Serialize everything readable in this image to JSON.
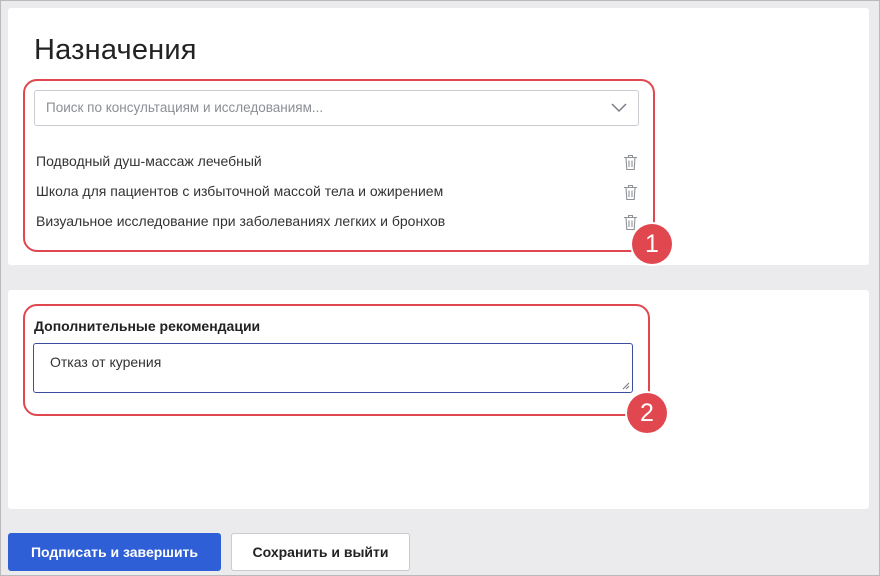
{
  "appointments": {
    "title": "Назначения",
    "search": {
      "placeholder": "Поиск по консультациям и исследованиям..."
    },
    "items": [
      {
        "label": "Подводный душ-массаж лечебный"
      },
      {
        "label": "Школа для пациентов с избыточной массой тела и ожирением"
      },
      {
        "label": "Визуальное исследование при заболеваниях легких и бронхов"
      }
    ],
    "badge": "1"
  },
  "recommendations": {
    "label": "Дополнительные рекомендации",
    "value": "Отказ от курения",
    "badge": "2"
  },
  "actions": {
    "sign_label": "Подписать и завершить",
    "save_label": "Сохранить и выйти"
  },
  "colors": {
    "accent": "#2f5fd6",
    "highlight": "#e0474f",
    "background": "#ebebed"
  }
}
